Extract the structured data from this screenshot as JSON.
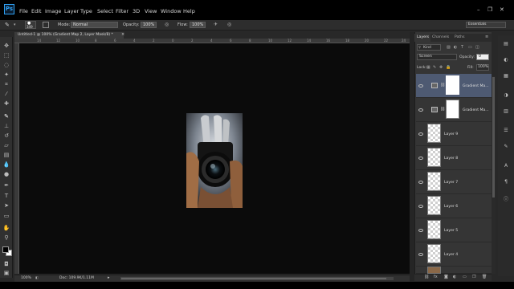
{
  "menubar": {
    "logo": "Ps",
    "items": [
      "File",
      "Edit",
      "Image",
      "Layer",
      "Type",
      "Select",
      "Filter",
      "3D",
      "View",
      "Window",
      "Help"
    ]
  },
  "options_bar": {
    "brush_size": "349",
    "mode_label": "Mode:",
    "mode_value": "Normal",
    "opacity_label": "Opacity:",
    "opacity_value": "100%",
    "flow_label": "Flow:",
    "flow_value": "100%",
    "workspace": "Essentials"
  },
  "document": {
    "tab_title": "Untitled-1 @ 100% (Gradient Map 2, Layer Mask/8) *",
    "ruler_ticks": [
      "14",
      "12",
      "10",
      "8",
      "6",
      "4",
      "2",
      "0",
      "2",
      "4",
      "6",
      "8",
      "10",
      "12",
      "14",
      "16",
      "18",
      "20",
      "22",
      "24"
    ]
  },
  "statusbar": {
    "zoom": "100%",
    "doc_info": "Doc: 109.9K/1.11M"
  },
  "layers_panel": {
    "tabs": [
      "Layers",
      "Channels",
      "Paths"
    ],
    "kind_label": "Kind",
    "blend_mode": "Screen",
    "opacity_label": "Opacity:",
    "opacity_value": "0",
    "lock_label": "Lock:",
    "fill_label": "Fill:",
    "fill_value": "100%",
    "layers": [
      {
        "name": "Gradient Ma...",
        "type": "adjustment",
        "selected": true
      },
      {
        "name": "Gradient Ma...",
        "type": "adjustment",
        "selected": false
      },
      {
        "name": "Layer 9",
        "type": "pixel",
        "selected": false
      },
      {
        "name": "Layer 8",
        "type": "pixel",
        "selected": false
      },
      {
        "name": "Layer 7",
        "type": "pixel",
        "selected": false
      },
      {
        "name": "Layer 6",
        "type": "pixel",
        "selected": false
      },
      {
        "name": "Layer 5",
        "type": "pixel",
        "selected": false
      },
      {
        "name": "Layer 4",
        "type": "pixel",
        "selected": false
      }
    ]
  },
  "colors": {
    "accent_selected": "#4e5a72",
    "ps_blue": "#2fa3f7",
    "canvas_bg": "#0b0b0b"
  }
}
